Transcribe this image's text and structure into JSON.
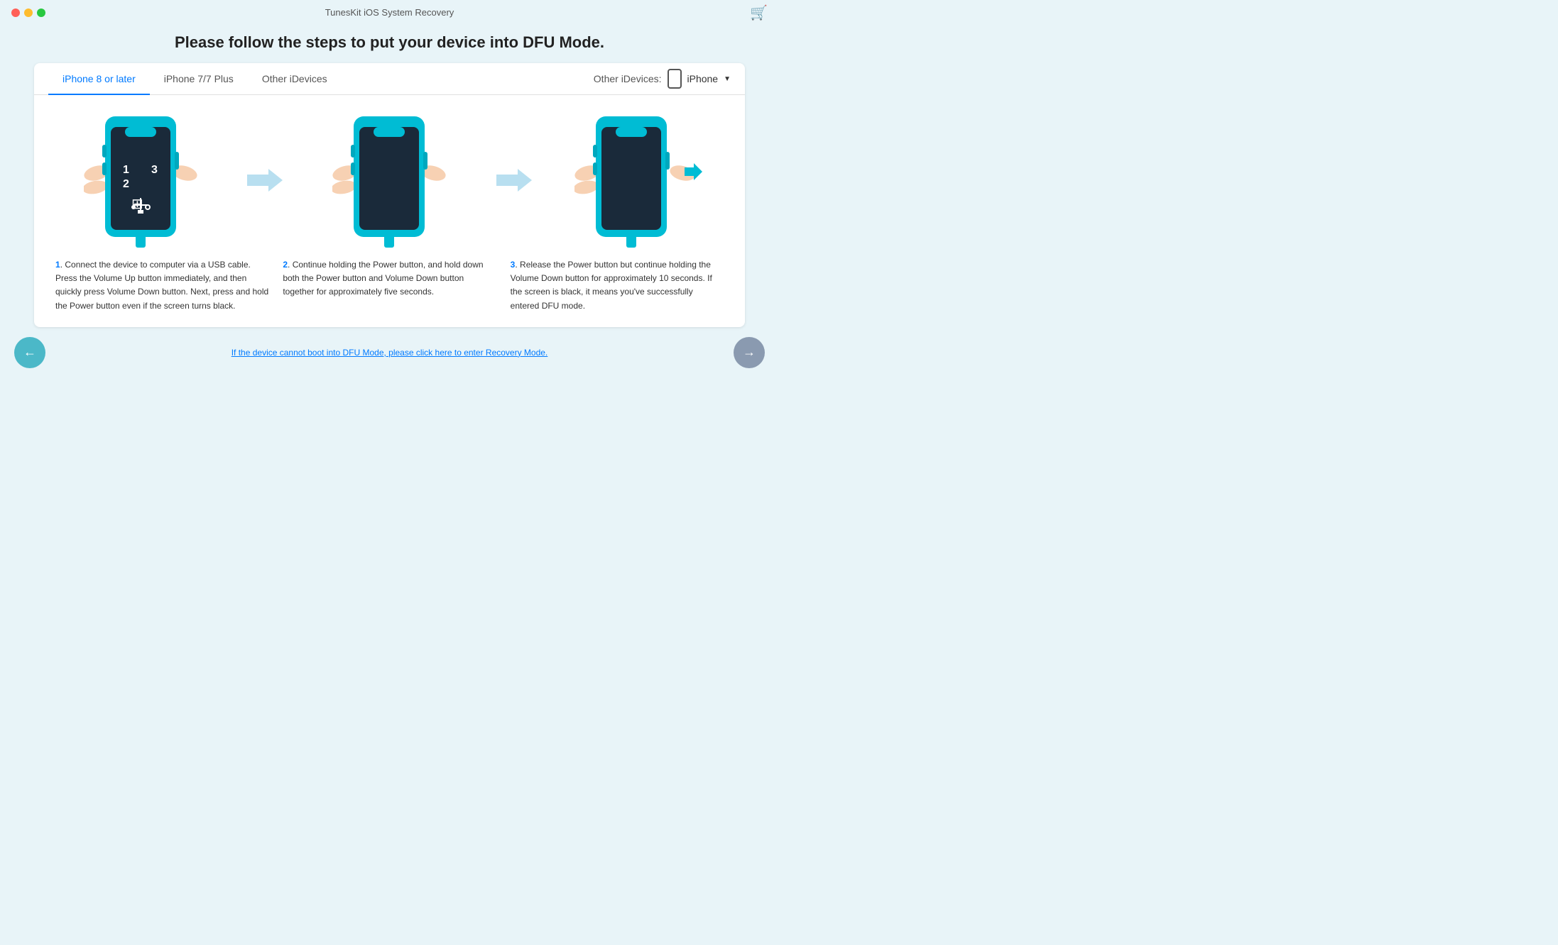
{
  "titleBar": {
    "title": "TunesKit iOS System Recovery",
    "controls": [
      "close",
      "minimize",
      "maximize"
    ]
  },
  "heading": "Please follow the steps to put your device into DFU Mode.",
  "tabs": [
    {
      "label": "iPhone 8 or later",
      "active": true
    },
    {
      "label": "iPhone 7/7 Plus",
      "active": false
    },
    {
      "label": "Other iDevices",
      "active": false
    }
  ],
  "otherDevices": {
    "label": "Other iDevices:",
    "deviceName": "iPhone"
  },
  "steps": [
    {
      "number": "1",
      "description": "Connect the device to computer via a USB cable. Press the Volume Up button immediately, and then quickly press Volume Down button. Next, press and hold the Power button even if the screen turns black."
    },
    {
      "number": "2",
      "description": "Continue holding the Power button, and hold down both the Power button and Volume Down button together for approximately five seconds."
    },
    {
      "number": "3",
      "description": "Release the Power button but continue holding the Volume Down button for approximately 10 seconds. If the screen is black, it means you've successfully entered DFU mode."
    }
  ],
  "recoveryLink": "If the device cannot boot into DFU Mode, please click here to enter Recovery Mode.",
  "navigation": {
    "backLabel": "←",
    "nextLabel": "→"
  }
}
